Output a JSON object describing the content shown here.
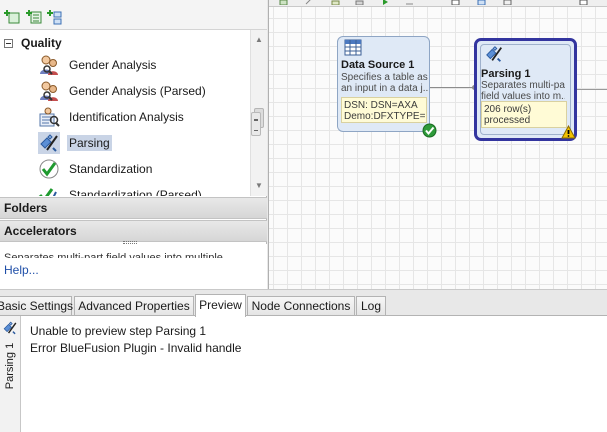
{
  "palette": {
    "accent": "#33359f",
    "link": "#1f4fa8",
    "selection": "#c9d4e6",
    "node_fill": "#dfe9f6",
    "note_fill": "#fffbd6",
    "ok_badge": "#2e9b3a",
    "warn_badge": "#e8b400"
  },
  "left_toolbar": {
    "icons": [
      "new-folder-icon",
      "new-item-icon",
      "tree-expand-icon"
    ]
  },
  "tree": {
    "category": {
      "label": "Quality",
      "expanded": true
    },
    "items": [
      {
        "label": "Gender Analysis",
        "icon": "gender-analysis-icon",
        "selected": false
      },
      {
        "label": "Gender Analysis (Parsed)",
        "icon": "gender-analysis-parsed-icon",
        "selected": false
      },
      {
        "label": "Identification Analysis",
        "icon": "identification-analysis-icon",
        "selected": false
      },
      {
        "label": "Parsing",
        "icon": "parsing-icon",
        "selected": true
      },
      {
        "label": "Standardization",
        "icon": "checkmark-icon",
        "selected": false
      },
      {
        "label": "Standardization (Parsed)",
        "icon": "checkmark-double-icon",
        "selected": false
      }
    ]
  },
  "sections": {
    "folders": "Folders",
    "accelerators": "Accelerators"
  },
  "help": {
    "description": "Separates multi-part field values into multiple",
    "link": "Help..."
  },
  "canvas": {
    "nodes": [
      {
        "id": "data_source",
        "title": "Data Source 1",
        "desc_line1": "Specifies a table as",
        "desc_line2": "an input in a data j...",
        "info_line1": "DSN: DSN=AXA",
        "info_line2": "Demo:DFXTYPE=...",
        "icon": "table-grid-icon",
        "status": "ok"
      },
      {
        "id": "parsing",
        "title": "Parsing 1",
        "desc_line1": "Separates multi-part",
        "desc_line2": "field values into m...",
        "info_line1": "206 row(s)",
        "info_line2": "processed",
        "icon": "parsing-icon",
        "status": "warning",
        "selected": true
      }
    ]
  },
  "tabs": [
    {
      "label": "Basic Settings",
      "active": false
    },
    {
      "label": "Advanced Properties",
      "active": false
    },
    {
      "label": "Preview",
      "active": true
    },
    {
      "label": "Node Connections",
      "active": false
    },
    {
      "label": "Log",
      "active": false
    }
  ],
  "preview": {
    "side_label": "Parsing 1",
    "messages": [
      "Unable to preview step Parsing 1",
      "Error BlueFusion Plugin - Invalid handle"
    ]
  }
}
